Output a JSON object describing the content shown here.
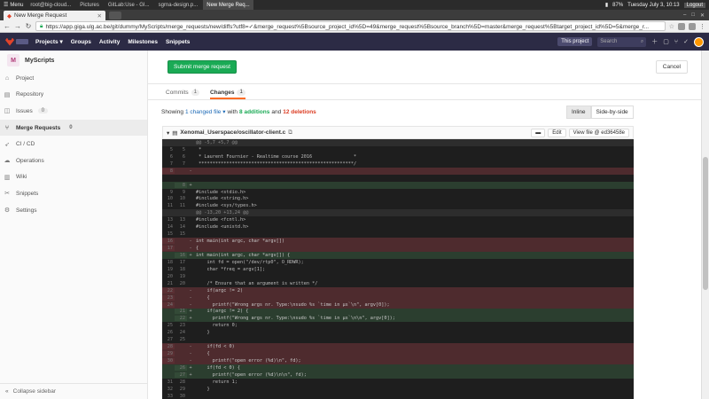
{
  "taskbar": {
    "menu_label": "Menu",
    "tasks": [
      {
        "label": "root@big-cloud...",
        "active": false
      },
      {
        "label": "Pictures",
        "active": false
      },
      {
        "label": "GitLab:Use - GI...",
        "active": false
      },
      {
        "label": "sgrna-design.p...",
        "active": false
      },
      {
        "label": "New Merge Req...",
        "active": true
      }
    ],
    "battery": "87%",
    "clock": "Tuesday July  3, 10:13",
    "user": "Logout"
  },
  "browser": {
    "tab_title": "New Merge Request",
    "url": "https://app.giga.ulg.ac.be/git/dummy/MyScripts/merge_requests/new/diffs?utf8=✓&merge_request%5Bsource_project_id%5D=49&merge_request%5Bsource_branch%5D=master&merge_request%5Btarget_project_id%5D=5&merge_r..."
  },
  "gitlab_nav": {
    "items": [
      "Projects ▾",
      "Groups",
      "Activity",
      "Milestones",
      "Snippets"
    ],
    "scope": "This project",
    "search_placeholder": "Search"
  },
  "sidebar": {
    "project_initial": "M",
    "project_name": "MyScripts",
    "items": [
      {
        "label": "Project",
        "icon": "home-icon",
        "glyph": "⌂"
      },
      {
        "label": "Repository",
        "icon": "doc-icon",
        "glyph": "▤"
      },
      {
        "label": "Issues",
        "icon": "issues-icon",
        "glyph": "◫",
        "badge": "0"
      },
      {
        "label": "Merge Requests",
        "icon": "merge-icon",
        "glyph": "⑂",
        "badge": "0",
        "active": true
      },
      {
        "label": "CI / CD",
        "icon": "rocket-icon",
        "glyph": "➶"
      },
      {
        "label": "Operations",
        "icon": "cloud-icon",
        "glyph": "☁"
      },
      {
        "label": "Wiki",
        "icon": "book-icon",
        "glyph": "▥"
      },
      {
        "label": "Snippets",
        "icon": "scissors-icon",
        "glyph": "✂"
      },
      {
        "label": "Settings",
        "icon": "gear-icon",
        "glyph": "⚙"
      }
    ],
    "collapse_label": "Collapse sidebar"
  },
  "main": {
    "submit_label": "Submit merge request",
    "cancel_label": "Cancel",
    "tabs": [
      {
        "label": "Commits",
        "count": "1",
        "active": false
      },
      {
        "label": "Changes",
        "count": "1",
        "active": true
      }
    ],
    "showing": {
      "prefix": "Showing",
      "changed": "1 changed file ▾",
      "with": "with",
      "additions": "8 additions",
      "and": "and",
      "deletions": "12 deletions"
    },
    "view_inline": "Inline",
    "view_side": "Side-by-side",
    "file": {
      "path": "Xenomai_Userspace/oscillator-client.c",
      "edit_label": "Edit",
      "view_label": "View file @ ed36458e"
    }
  },
  "diff_lines": [
    {
      "t": "match",
      "o": "",
      "n": "",
      "s": "",
      "c": "@@ -5,7 +5,7 @@"
    },
    {
      "t": "ctx",
      "o": "5",
      "n": "5",
      "s": "",
      "c": " *"
    },
    {
      "t": "ctx",
      "o": "6",
      "n": "6",
      "s": "",
      "c": " * Laurent Fournier - Realtime course 2016               *"
    },
    {
      "t": "ctx",
      "o": "7",
      "n": "7",
      "s": "",
      "c": " ********************************************************/"
    },
    {
      "t": "del",
      "o": "8",
      "n": "",
      "s": "-",
      "c": ""
    },
    {
      "t": "ctx",
      "o": "",
      "n": "",
      "s": "",
      "c": ""
    },
    {
      "t": "add",
      "o": "",
      "n": "8",
      "s": "+",
      "c": ""
    },
    {
      "t": "ctx",
      "o": "9",
      "n": "9",
      "s": "",
      "c": "#include <stdio.h>"
    },
    {
      "t": "ctx",
      "o": "10",
      "n": "10",
      "s": "",
      "c": "#include <string.h>"
    },
    {
      "t": "ctx",
      "o": "11",
      "n": "11",
      "s": "",
      "c": "#include <sys/types.h>"
    },
    {
      "t": "match",
      "o": "",
      "n": "",
      "s": "",
      "c": "@@ -13,20 +13,24 @@"
    },
    {
      "t": "ctx",
      "o": "13",
      "n": "13",
      "s": "",
      "c": "#include <fcntl.h>"
    },
    {
      "t": "ctx",
      "o": "14",
      "n": "14",
      "s": "",
      "c": "#include <unistd.h>"
    },
    {
      "t": "ctx",
      "o": "15",
      "n": "15",
      "s": "",
      "c": ""
    },
    {
      "t": "del",
      "o": "16",
      "n": "",
      "s": "-",
      "c": "int main(int argc, char *argv[])"
    },
    {
      "t": "del",
      "o": "17",
      "n": "",
      "s": "-",
      "c": "{"
    },
    {
      "t": "add",
      "o": "",
      "n": "16",
      "s": "+",
      "c": "int main(int argc, char *argv[]) {"
    },
    {
      "t": "ctx",
      "o": "18",
      "n": "17",
      "s": "",
      "c": "    int fd = open(\"/dev/rtp0\", O_RDWR);"
    },
    {
      "t": "ctx",
      "o": "19",
      "n": "18",
      "s": "",
      "c": "    char *freq = argv[1];"
    },
    {
      "t": "ctx",
      "o": "20",
      "n": "19",
      "s": "",
      "c": ""
    },
    {
      "t": "ctx",
      "o": "21",
      "n": "20",
      "s": "",
      "c": "    /* Ensure that an argument is written */"
    },
    {
      "t": "del",
      "o": "22",
      "n": "",
      "s": "-",
      "c": "    if(argc != 2)"
    },
    {
      "t": "del",
      "o": "23",
      "n": "",
      "s": "-",
      "c": "    {"
    },
    {
      "t": "del",
      "o": "24",
      "n": "",
      "s": "-",
      "c": "      printf(\"Wrong args nr. Type:\\nsudo %s `time in µs`\\n\", argv[0]);"
    },
    {
      "t": "add",
      "o": "",
      "n": "21",
      "s": "+",
      "c": "    if(argc != 2) {"
    },
    {
      "t": "add",
      "o": "",
      "n": "22",
      "s": "+",
      "c": "      printf(\"Wrong args nr. Type:\\nsudo %s `time in µs`\\n\\n\", argv[0]);"
    },
    {
      "t": "ctx",
      "o": "25",
      "n": "23",
      "s": "",
      "c": "      return 0;"
    },
    {
      "t": "ctx",
      "o": "26",
      "n": "24",
      "s": "",
      "c": "    }"
    },
    {
      "t": "ctx",
      "o": "27",
      "n": "25",
      "s": "",
      "c": ""
    },
    {
      "t": "del",
      "o": "28",
      "n": "",
      "s": "-",
      "c": "    if(fd < 0)"
    },
    {
      "t": "del",
      "o": "29",
      "n": "",
      "s": "-",
      "c": "    {"
    },
    {
      "t": "del",
      "o": "30",
      "n": "",
      "s": "-",
      "c": "      printf(\"open error (%d)\\n\", fd);"
    },
    {
      "t": "add",
      "o": "",
      "n": "26",
      "s": "+",
      "c": "    if(fd < 0) {"
    },
    {
      "t": "add",
      "o": "",
      "n": "27",
      "s": "+",
      "c": "      printf(\"open error (%d)\\n\\n\", fd);"
    },
    {
      "t": "ctx",
      "o": "31",
      "n": "28",
      "s": "",
      "c": "      return 1;"
    },
    {
      "t": "ctx",
      "o": "32",
      "n": "29",
      "s": "",
      "c": "    }"
    },
    {
      "t": "ctx",
      "o": "33",
      "n": "30",
      "s": "",
      "c": ""
    },
    {
      "t": "ctx",
      "o": "34",
      "n": "31",
      "s": "",
      "c": "    /* Send through a pipe to Xenomai argument's value to change oscillator's frequency */"
    }
  ]
}
